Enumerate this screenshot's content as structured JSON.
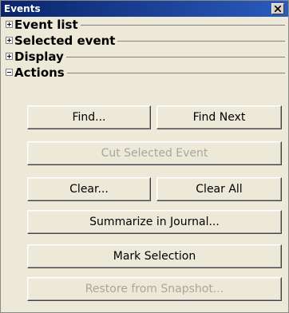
{
  "window": {
    "title": "Events",
    "close_glyph": "×"
  },
  "sections": [
    {
      "label": "Event list",
      "state": "collapsed"
    },
    {
      "label": "Selected event",
      "state": "collapsed"
    },
    {
      "label": "Display",
      "state": "collapsed"
    },
    {
      "label": "Actions",
      "state": "expanded"
    }
  ],
  "actions": {
    "find": {
      "label": "Find...",
      "enabled": true
    },
    "find_next": {
      "label": "Find Next",
      "enabled": true
    },
    "cut_selected": {
      "label": "Cut Selected Event",
      "enabled": false
    },
    "clear": {
      "label": "Clear...",
      "enabled": true
    },
    "clear_all": {
      "label": "Clear All",
      "enabled": true
    },
    "summarize": {
      "label": "Summarize in Journal...",
      "enabled": true
    },
    "mark_selection": {
      "label": "Mark Selection",
      "enabled": true
    },
    "restore": {
      "label": "Restore from Snapshot...",
      "enabled": false
    }
  },
  "colors": {
    "titlebar_start": "#0a246a",
    "titlebar_end": "#2a5bbd",
    "panel_bg": "#ece9d8",
    "disabled_text": "#a9a79b"
  }
}
